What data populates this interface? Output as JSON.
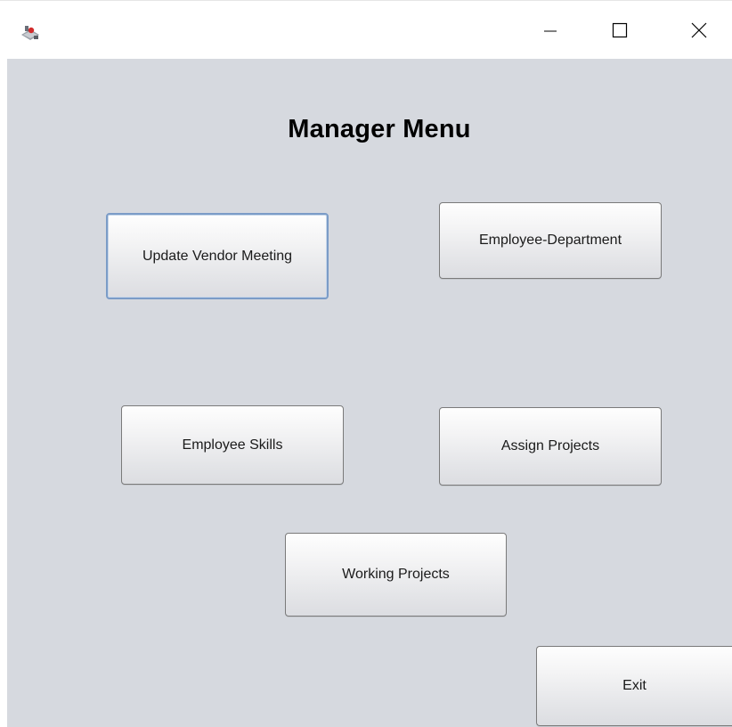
{
  "window": {
    "app_icon": "java-app-icon",
    "controls": {
      "minimize_icon": "minimize-icon",
      "maximize_icon": "maximize-icon",
      "close_icon": "close-icon"
    }
  },
  "main": {
    "title": "Manager Menu",
    "buttons": {
      "update_vendor_meeting": "Update Vendor Meeting",
      "employee_department": "Employee-Department",
      "employee_skills": "Employee Skills",
      "assign_projects": "Assign Projects",
      "working_projects": "Working Projects",
      "exit": "Exit"
    }
  },
  "colors": {
    "panel_background": "#d6d9df",
    "focus_border": "#7b9cc7"
  }
}
